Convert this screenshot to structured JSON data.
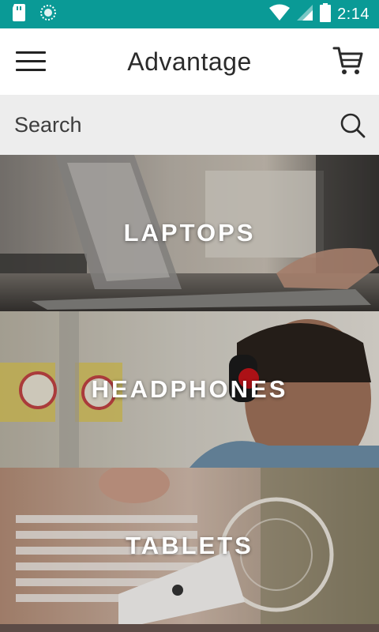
{
  "status_bar": {
    "time": "2:14",
    "left_icons": [
      "sd-card-icon",
      "sync-icon"
    ],
    "right_icons": [
      "wifi-icon",
      "signal-icon",
      "battery-icon"
    ],
    "color": "#0a9a96"
  },
  "app_bar": {
    "title": "Advantage",
    "menu_icon": "hamburger-menu-icon",
    "cart_icon": "shopping-cart-icon"
  },
  "search": {
    "placeholder": "Search",
    "icon": "search-icon"
  },
  "categories": [
    {
      "label": "LAPTOPS"
    },
    {
      "label": "HEADPHONES"
    },
    {
      "label": "TABLETS"
    }
  ]
}
